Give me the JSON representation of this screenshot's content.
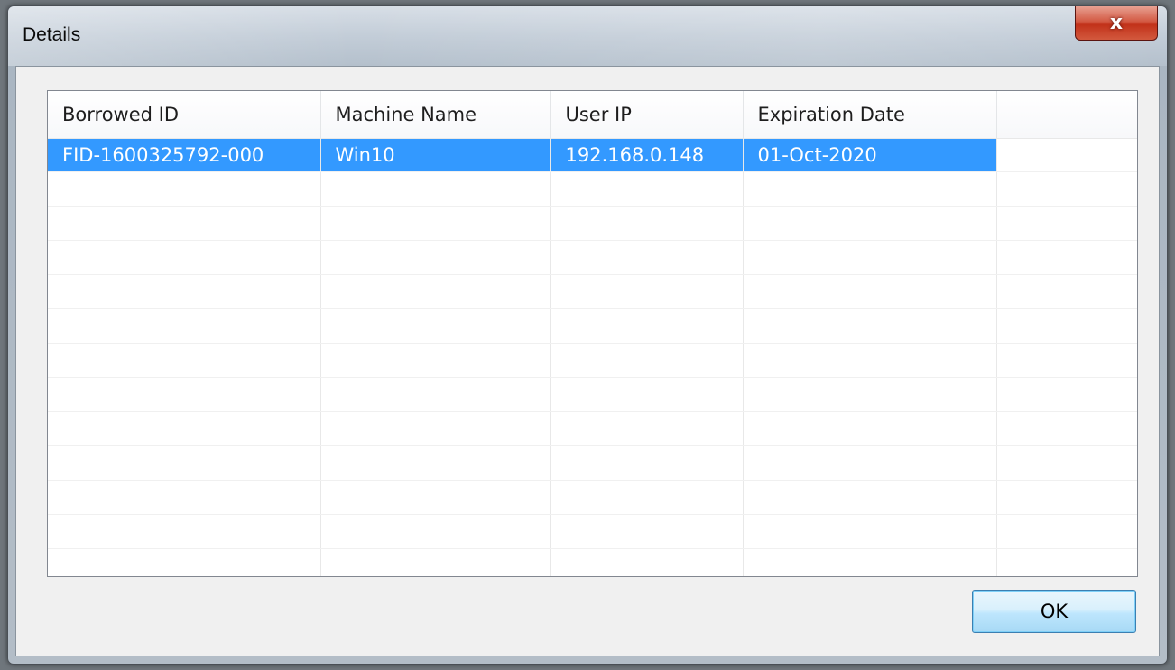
{
  "window": {
    "title": "Details",
    "close_symbol": "x"
  },
  "list": {
    "columns": [
      "Borrowed ID",
      "Machine Name",
      "User IP",
      "Expiration Date",
      ""
    ],
    "rows": [
      [
        "FID-1600325792-000",
        "Win10",
        "192.168.0.148",
        "01-Oct-2020"
      ]
    ],
    "selected_row": 0
  },
  "buttons": {
    "ok_label": "OK"
  },
  "colors": {
    "selection": "#3399ff",
    "close_button": "#c2321a"
  }
}
